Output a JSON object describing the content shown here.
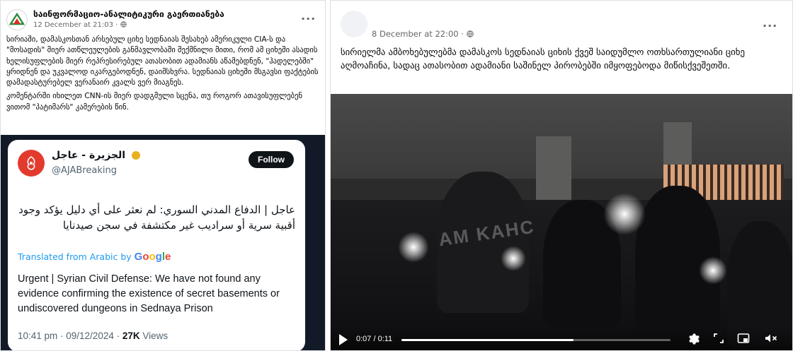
{
  "left_post": {
    "page_name": "საინფორმაციო-ანალიტიკური გაერთიანება",
    "timestamp": "12 December at 21:03 · ",
    "more_label": "···",
    "paragraph_1": "სირიაში, დამასკოსთან არსებულ ციხე სედნაიას შესახებ ამერიკული CIA-ს და \"მოსადის\" მიერ ათწლეულების განმავლობაში შექმნილი მითი, რომ ამ ციხეში ასადის ხელისუფლების მიერ რეპრესირებულ ათასობით ადამიანს აწამებდნენ, \"ჰადელებში\" ყრიდნენ და უკვალოდ იკარგებოდნენ, დაიმსხვრა. სედნაიას ციხეში მსგავსი ფაქტების დამადასტურებელ ვერანაირ კვალს ვერ მიაგნეს.",
    "paragraph_2": "კომენტარში იხილეთ CNN-ის მიერ დადგმული სცენა, თუ როგორ ათავისუფლებენ ვითომ \"პატიმარს\" კამერების წინ.",
    "tweet": {
      "display_name": "الجزيرة - عاجل",
      "handle": "@AJABreaking",
      "follow_label": "Follow",
      "arabic_text": "عاجل | الدفاع المدني السوري: لم نعثر على أي دليل يؤكد وجود أقبية سرية أو سراديب غير مكتشفة في سجن صيدنايا",
      "translated_label": "Translated from Arabic by",
      "google_letters": [
        "G",
        "o",
        "o",
        "g",
        "l",
        "e"
      ],
      "english_text": "Urgent | Syrian Civil Defense: We have not found any evidence confirming the existence of secret basements or undiscovered dungeons in Sednaya Prison",
      "datetime": "10:41 pm · 09/12/2024 · ",
      "views_count": "27K",
      "views_label": " Views"
    }
  },
  "right_post": {
    "timestamp": "8 December at 22:00 · ",
    "more_label": "···",
    "text": "სირიელმა ამბოხებულებმა დამასკოს სედნაიას ციხის ქვეშ საიდუმლო ოთხსართულიანი ციხე აღმოაჩინა, სადაც ათასობით ადამიანი საშინელ პირობებში იმყოფებოდა მიწისქვეშეთში.",
    "video": {
      "watermark": "AM KAHC",
      "timecode": "0:07 / 0:11",
      "progress": 0.64,
      "icons": [
        "play-icon",
        "settings-icon",
        "fullscreen-icon",
        "picture-in-picture-icon",
        "volume-muted-icon"
      ]
    }
  },
  "colors": {
    "facebook_text_secondary": "#65676b",
    "tweet_link_blue": "#1d9bf0",
    "aljazeera_red": "#e23b2e",
    "tweet_dark": "#0f1419"
  }
}
